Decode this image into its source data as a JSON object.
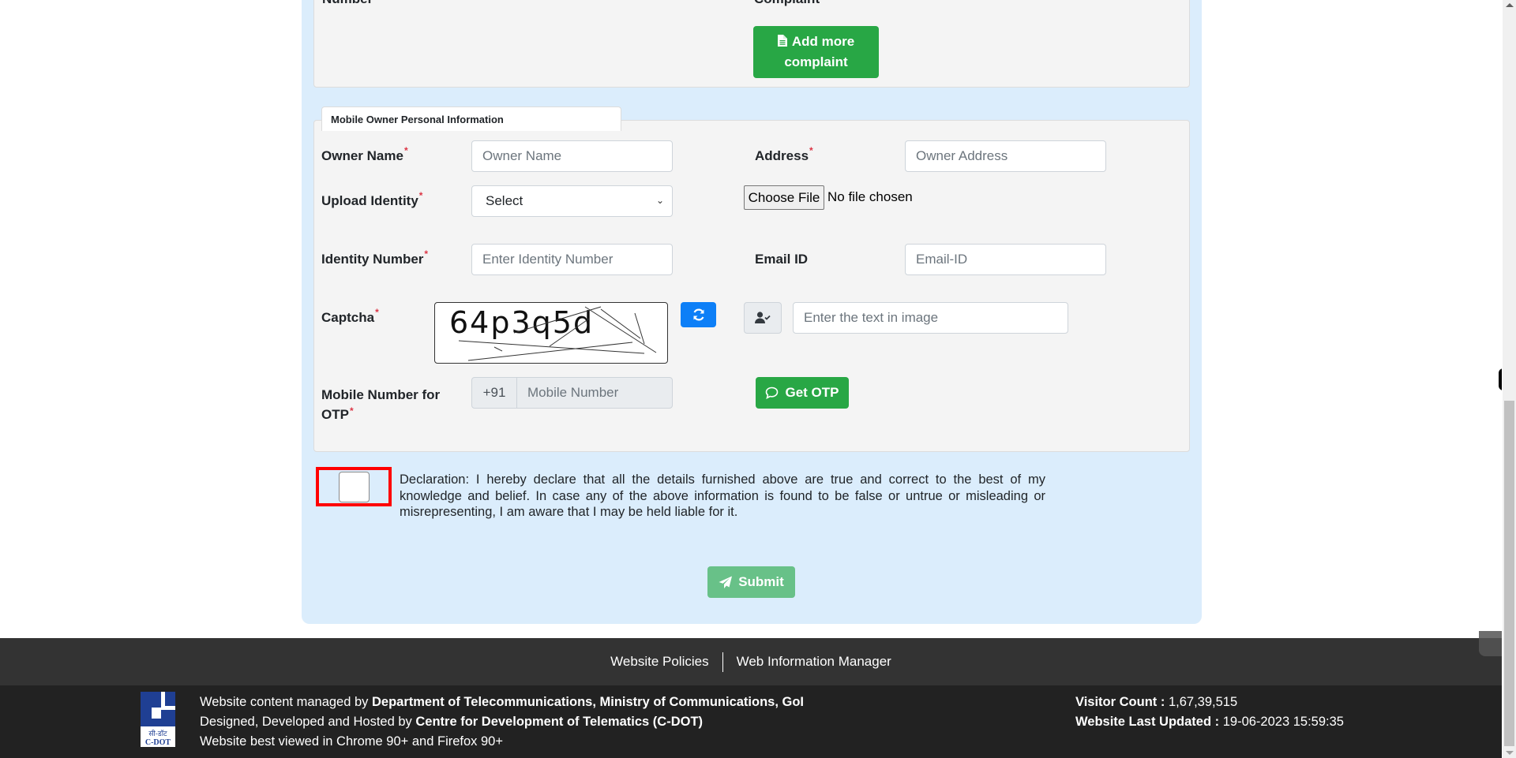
{
  "top_section": {
    "cut_label_left": "Number",
    "cut_label_right": "Complaint",
    "add_more_button": "Add more complaint",
    "add_more_icon": "file-icon"
  },
  "owner_section": {
    "legend": "Mobile Owner Personal Information",
    "owner_name": {
      "label": "Owner Name",
      "required": "*",
      "placeholder": "Owner Name",
      "value": ""
    },
    "address": {
      "label": "Address",
      "required": "*",
      "placeholder": "Owner Address",
      "value": ""
    },
    "upload_identity": {
      "label": "Upload Identity",
      "required": "*",
      "selected": "Select"
    },
    "file_input": {
      "button": "Choose File",
      "status": "No file chosen"
    },
    "identity_number": {
      "label": "Identity Number",
      "required": "*",
      "placeholder": "Enter Identity Number",
      "value": ""
    },
    "email": {
      "label": "Email ID",
      "placeholder": "Email-ID",
      "value": ""
    },
    "captcha": {
      "label": "Captcha",
      "required": "*",
      "image_text": "64p3q5d",
      "refresh_icon": "refresh-icon",
      "user_check_icon": "user-check-icon",
      "input_placeholder": "Enter the text in image"
    },
    "mobile": {
      "label": "Mobile Number for OTP",
      "required": "*",
      "prefix": "+91",
      "placeholder": "Mobile Number",
      "value": ""
    },
    "get_otp_button": "Get OTP",
    "get_otp_icon": "chat-bubble-icon"
  },
  "declaration": {
    "checked": false,
    "text": "Declaration: I hereby declare that all the details furnished above are true and correct to the best of my knowledge and belief. In case any of the above information is found to be false or untrue or misleading or misrepresenting, I am aware that I may be held liable for it."
  },
  "submit": {
    "label": "Submit",
    "icon": "paper-plane-icon"
  },
  "footer": {
    "links": [
      "Website Policies",
      "Web Information Manager"
    ],
    "logo_text_hindi": "सी-डॉट",
    "logo_text": "C-DOT",
    "line1_prefix": "Website content managed by ",
    "line1_bold": "Department of Telecommunications, Ministry of Communications, GoI",
    "line2_prefix": "Designed, Developed and Hosted by ",
    "line2_bold": "Centre for Development of Telematics (C-DOT)",
    "line3": "Website best viewed in Chrome 90+ and Firefox 90+",
    "visitor_label": "Visitor Count : ",
    "visitor_count": "1,67,39,515",
    "updated_label": "Website Last Updated : ",
    "updated_value": "19-06-2023 15:59:35"
  },
  "colors": {
    "panel_bg": "#dbedfc",
    "success_green": "#28a745",
    "primary_blue": "#0d7ff7",
    "highlight_red": "#ff0000",
    "footer_dark": "#222222"
  }
}
